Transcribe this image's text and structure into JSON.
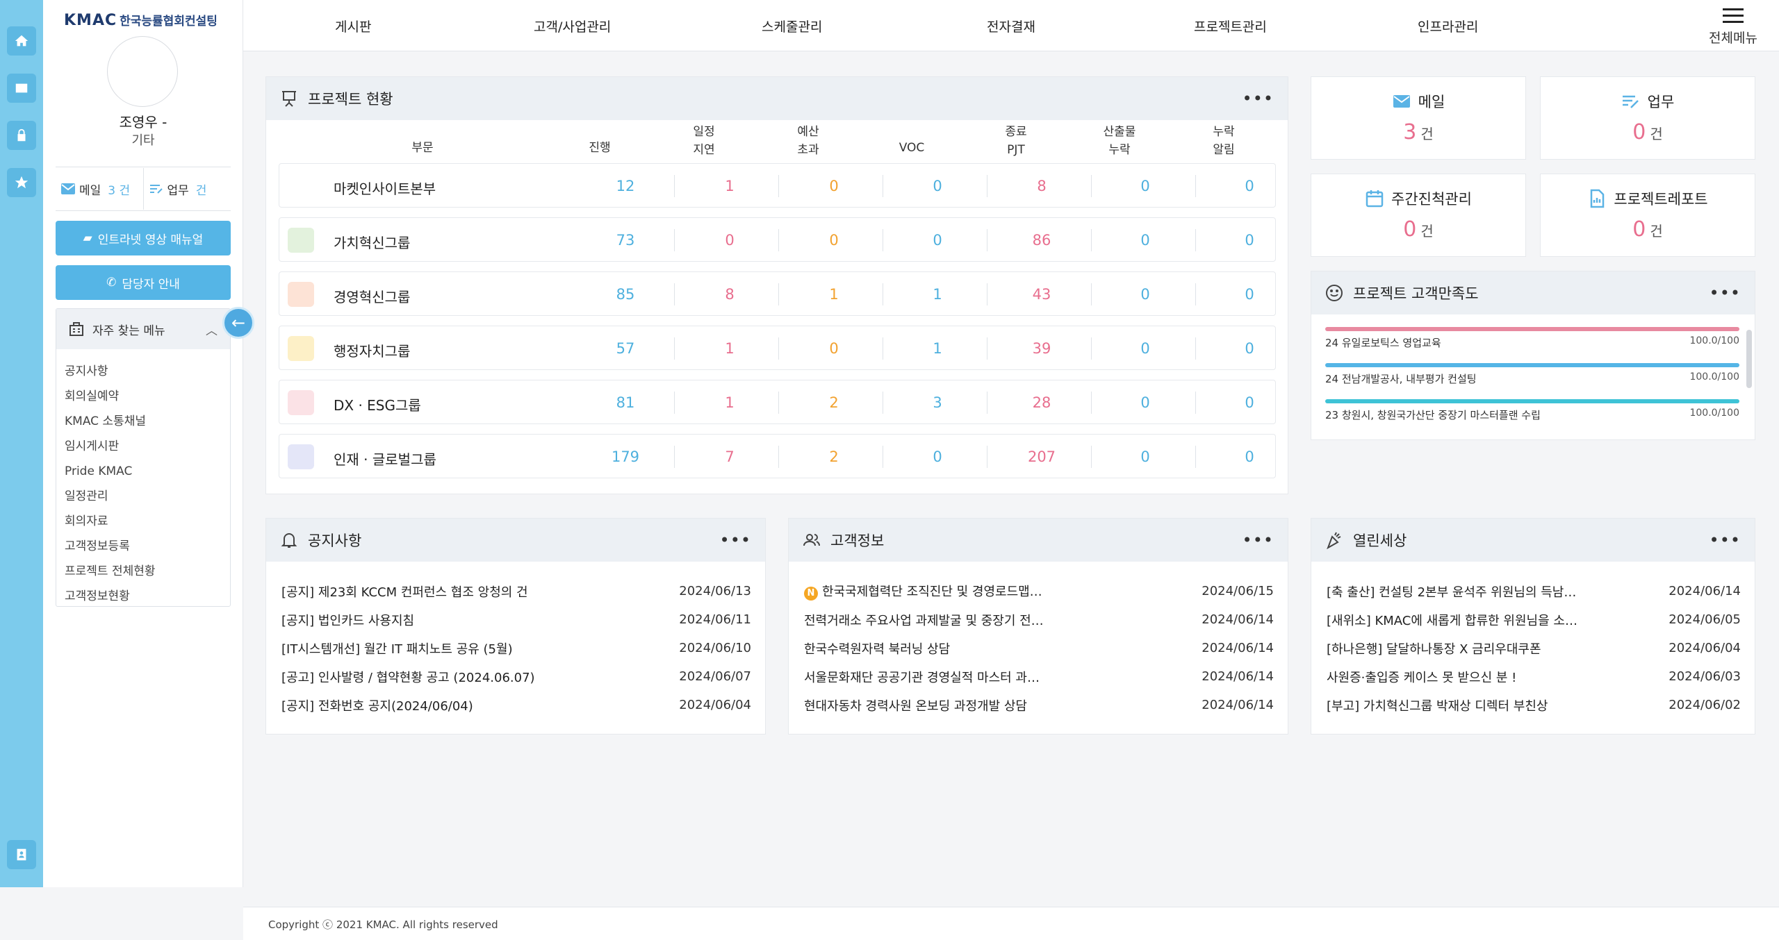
{
  "sidebar": {
    "logo": "KMAC",
    "logo_sub": "한국능률협회컨설팅",
    "user_name": "조영우 -",
    "user_role": "기타",
    "mail_label": "메일",
    "mail_count": "3 건",
    "task_label": "업무",
    "task_count": "건",
    "btn_manual": "인트라넷 영상 매뉴얼",
    "btn_contact": "담당자 안내",
    "fav_title": "자주 찾는 메뉴",
    "fav_items": [
      "공지사항",
      "회의실예약",
      "KMAC 소통채널",
      "임시게시판",
      "Pride KMAC",
      "일정관리",
      "회의자료",
      "고객정보등록",
      "프로젝트 전체현황",
      "고객정보현황"
    ]
  },
  "topnav": {
    "items": [
      "게시판",
      "고객/사업관리",
      "스케줄관리",
      "전자결재",
      "프로젝트관리",
      "인프라관리"
    ],
    "all_menu": "전체메뉴"
  },
  "project_status": {
    "title": "프로젝트 현황",
    "headers": {
      "dept": "부문",
      "progress": "진행",
      "delay_1": "일정",
      "delay_2": "지연",
      "budget_1": "예산",
      "budget_2": "초과",
      "voc": "VOC",
      "end_1": "종료",
      "end_2": "PJT",
      "output_1": "산출물",
      "output_2": "누락",
      "alarm_1": "누락",
      "alarm_2": "알림"
    },
    "rows": [
      {
        "name": "마켓인사이트본부",
        "progress": "12",
        "delay": "1",
        "budget": "0",
        "voc": "0",
        "end": "8",
        "output": "0",
        "alarm": "0",
        "icon": "none",
        "color": ""
      },
      {
        "name": "가치혁신그룹",
        "progress": "73",
        "delay": "0",
        "budget": "0",
        "voc": "0",
        "end": "86",
        "output": "0",
        "alarm": "0",
        "icon": "chart-icon",
        "color": "#e3f2dd"
      },
      {
        "name": "경영혁신그룹",
        "progress": "85",
        "delay": "8",
        "budget": "1",
        "voc": "1",
        "end": "43",
        "output": "0",
        "alarm": "0",
        "icon": "globe-icon",
        "color": "#fde3d6"
      },
      {
        "name": "행정자치그룹",
        "progress": "57",
        "delay": "1",
        "budget": "0",
        "voc": "1",
        "end": "39",
        "output": "0",
        "alarm": "0",
        "icon": "image-icon",
        "color": "#fdf0c7"
      },
      {
        "name": "DX · ESG그룹",
        "progress": "81",
        "delay": "1",
        "budget": "2",
        "voc": "3",
        "end": "28",
        "output": "0",
        "alarm": "0",
        "icon": "eco-icon",
        "color": "#fbe2e6"
      },
      {
        "name": "인재 · 글로벌그룹",
        "progress": "179",
        "delay": "7",
        "budget": "2",
        "voc": "0",
        "end": "207",
        "output": "0",
        "alarm": "0",
        "icon": "people-icon",
        "color": "#e4e6f8"
      }
    ]
  },
  "stats": {
    "mail": {
      "label": "메일",
      "value": "3",
      "unit": "건"
    },
    "task": {
      "label": "업무",
      "value": "0",
      "unit": "건"
    },
    "weekly": {
      "label": "주간진척관리",
      "value": "0",
      "unit": "건"
    },
    "report": {
      "label": "프로젝트레포트",
      "value": "0",
      "unit": "건"
    }
  },
  "satisfaction": {
    "title": "프로젝트 고객만족도",
    "items": [
      {
        "name": "24 유일로보틱스 영업교육",
        "score": "100.0/100",
        "color": "#e88aa0",
        "pct": 100
      },
      {
        "name": "24 전남개발공사, 내부평가 컨설팅",
        "score": "100.0/100",
        "color": "#55b5e6",
        "pct": 100
      },
      {
        "name": "23 창원시, 창원국가산단 중장기 마스터플랜 수립",
        "score": "100.0/100",
        "color": "#3ec3d6",
        "pct": 100
      }
    ]
  },
  "notice": {
    "title": "공지사항",
    "items": [
      {
        "title": "[공지] 제23회 KCCM 컨퍼런스 협조 앙청의 건",
        "date": "2024/06/13"
      },
      {
        "title": "[공지] 법인카드 사용지침",
        "date": "2024/06/11"
      },
      {
        "title": "[IT시스템개선] 월간 IT 패치노트 공유 (5월)",
        "date": "2024/06/10"
      },
      {
        "title": "[공고] 인사발령 / 협약현황 공고 (2024.06.07)",
        "date": "2024/06/07"
      },
      {
        "title": "[공지] 전화번호 공지(2024/06/04)",
        "date": "2024/06/04"
      }
    ]
  },
  "customer": {
    "title": "고객정보",
    "badge": "N",
    "items": [
      {
        "title": "한국국제협력단 조직진단 및 경영로드맵…",
        "date": "2024/06/15"
      },
      {
        "title": "전력거래소 주요사업 과제발굴 및 중장기 전…",
        "date": "2024/06/14"
      },
      {
        "title": "한국수력원자력 북러닝 상담",
        "date": "2024/06/14"
      },
      {
        "title": "서울문화재단 공공기관 경영실적 마스터 과…",
        "date": "2024/06/14"
      },
      {
        "title": "현대자동차 경력사원 온보딩 과정개발 상담",
        "date": "2024/06/14"
      }
    ]
  },
  "open_world": {
    "title": "열린세상",
    "items": [
      {
        "title": "[축 출산] 컨설팅 2본부 윤석주 위원님의 득남…",
        "date": "2024/06/14"
      },
      {
        "title": "[새위소] KMAC에 새롭게 합류한 위원님을 소…",
        "date": "2024/06/05"
      },
      {
        "title": "[하나은행] 달달하나통장 X 금리우대쿠폰",
        "date": "2024/06/04"
      },
      {
        "title": "사원증·출입증 케이스 못 받으신 분 !",
        "date": "2024/06/03"
      },
      {
        "title": "[부고] 가치혁신그룹 박재상 디렉터 부친상",
        "date": "2024/06/02"
      }
    ]
  },
  "footer": "Copyright ⓒ 2021 KMAC. All rights reserved",
  "colors": {
    "accent": "#55b5e6",
    "rail": "#7ccbec",
    "pink": "#e86e8e",
    "orange": "#f2a230",
    "blue": "#4eb0de"
  }
}
